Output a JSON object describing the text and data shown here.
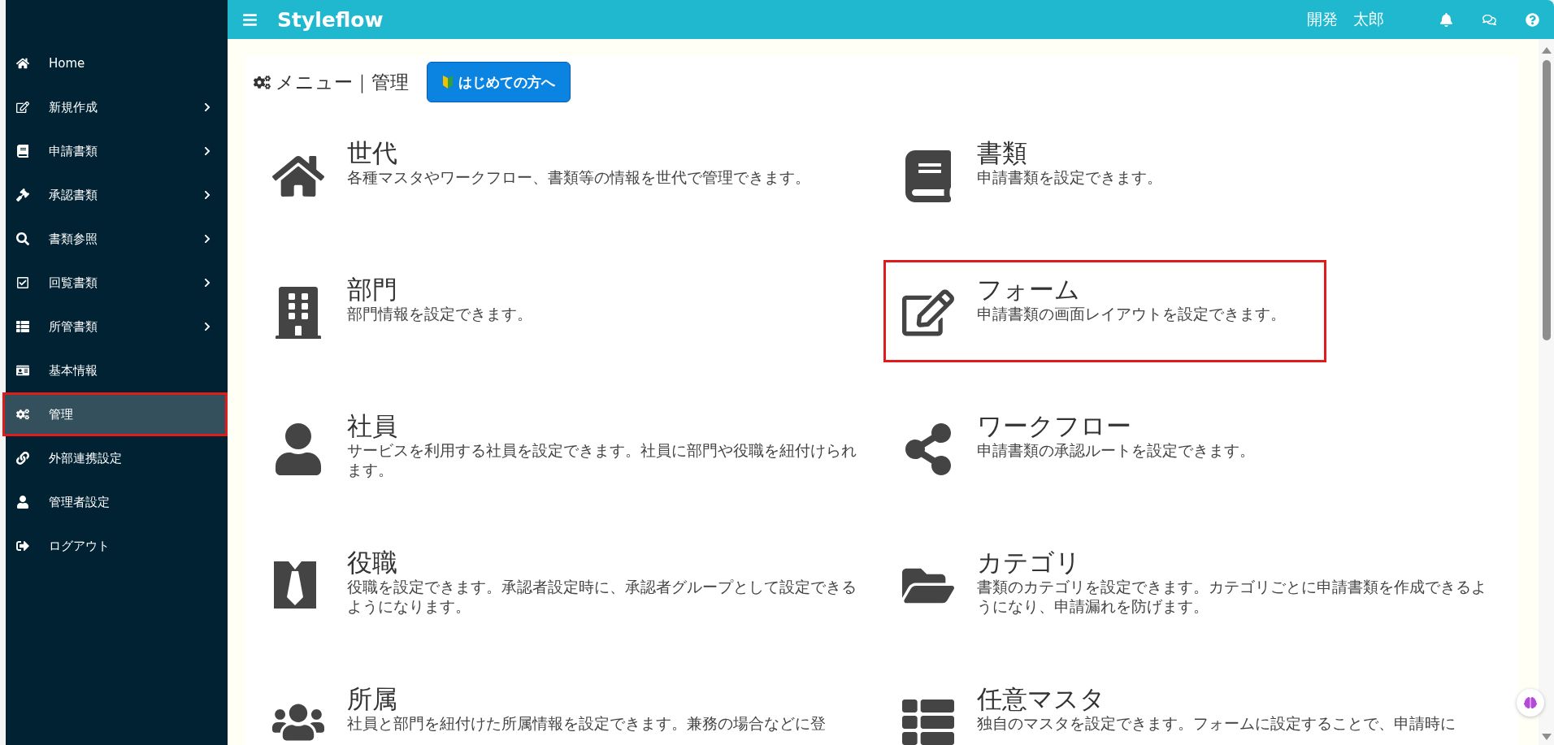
{
  "header": {
    "app_name": "Styleflow",
    "user_name": "開発　太郎"
  },
  "sidebar": {
    "items": [
      {
        "label": "Home",
        "selected": false,
        "highlighted": false,
        "has_submenu": false
      },
      {
        "label": "新規作成",
        "selected": false,
        "highlighted": false,
        "has_submenu": true
      },
      {
        "label": "申請書類",
        "selected": false,
        "highlighted": false,
        "has_submenu": true
      },
      {
        "label": "承認書類",
        "selected": false,
        "highlighted": false,
        "has_submenu": true
      },
      {
        "label": "書類参照",
        "selected": false,
        "highlighted": false,
        "has_submenu": true
      },
      {
        "label": "回覧書類",
        "selected": false,
        "highlighted": false,
        "has_submenu": true
      },
      {
        "label": "所管書類",
        "selected": false,
        "highlighted": false,
        "has_submenu": true
      },
      {
        "label": "基本情報",
        "selected": false,
        "highlighted": false,
        "has_submenu": false
      },
      {
        "label": "管理",
        "selected": true,
        "highlighted": true,
        "has_submenu": false
      },
      {
        "label": "外部連携設定",
        "selected": false,
        "highlighted": false,
        "has_submenu": false
      },
      {
        "label": "管理者設定",
        "selected": false,
        "highlighted": false,
        "has_submenu": false
      },
      {
        "label": "ログアウト",
        "selected": false,
        "highlighted": false,
        "has_submenu": false
      }
    ]
  },
  "page_title": "メニュー｜管理",
  "guide_button": "はじめての方へ",
  "menu_items": [
    {
      "title": "世代",
      "description": "各種マスタやワークフロー、書類等の情報を世代で管理できます。",
      "highlighted": false
    },
    {
      "title": "書類",
      "description": "申請書類を設定できます。",
      "highlighted": false
    },
    {
      "title": "部門",
      "description": "部門情報を設定できます。",
      "highlighted": false
    },
    {
      "title": "フォーム",
      "description": "申請書類の画面レイアウトを設定できます。",
      "highlighted": true
    },
    {
      "title": "社員",
      "description": "サービスを利用する社員を設定できます。社員に部門や役職を紐付けられます。",
      "highlighted": false
    },
    {
      "title": "ワークフロー",
      "description": "申請書類の承認ルートを設定できます。",
      "highlighted": false
    },
    {
      "title": "役職",
      "description": "役職を設定できます。承認者設定時に、承認者グループとして設定できるようになります。",
      "highlighted": false
    },
    {
      "title": "カテゴリ",
      "description": "書類のカテゴリを設定できます。カテゴリごとに申請書類を作成できるようになり、申請漏れを防げます。",
      "highlighted": false
    },
    {
      "title": "所属",
      "description": "社員と部門を紐付けた所属情報を設定できます。兼務の場合などに登",
      "highlighted": false
    },
    {
      "title": "任意マスタ",
      "description": "独自のマスタを設定できます。フォームに設定することで、申請時に",
      "highlighted": false
    }
  ]
}
